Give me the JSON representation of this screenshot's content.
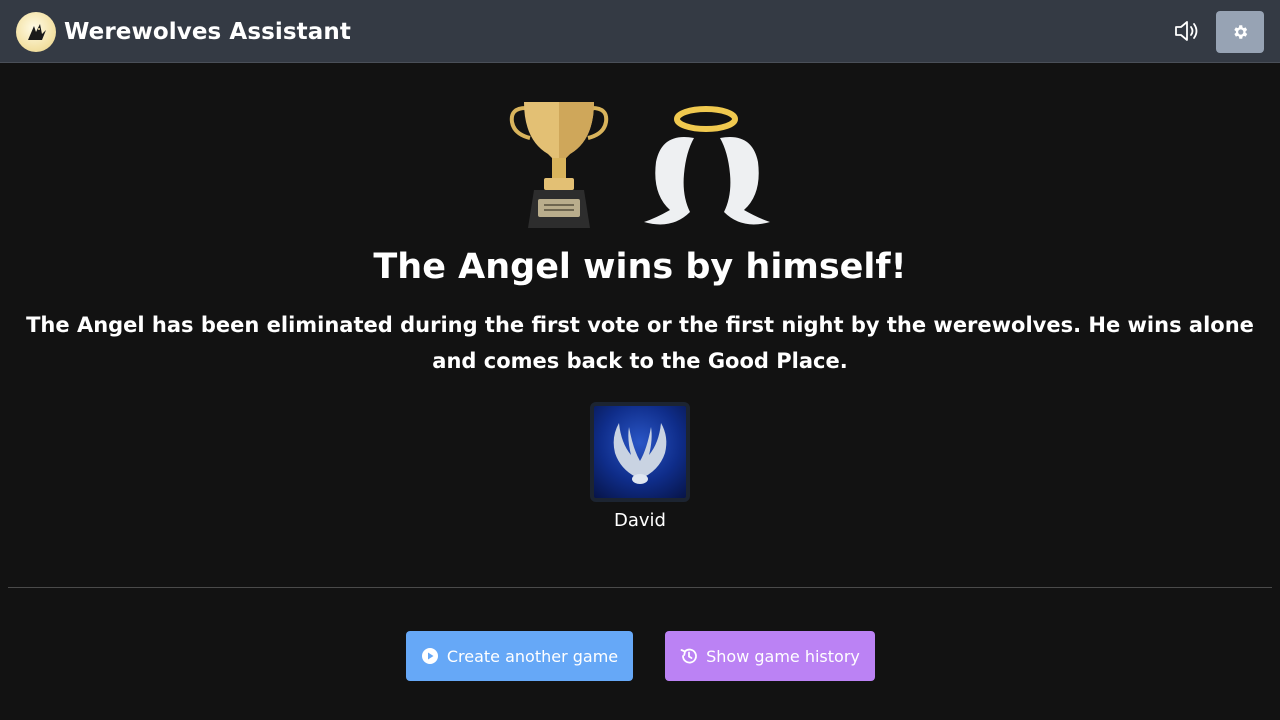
{
  "app": {
    "title": "Werewolves Assistant",
    "logo_icon": "werewolf-logo-icon"
  },
  "navbar": {
    "sound_icon": "volume-icon",
    "settings_icon": "gear-icon"
  },
  "victory": {
    "images": [
      "trophy-icon",
      "angel-wings-icon"
    ],
    "headline": "The Angel wins by himself!",
    "description": "The Angel has been eliminated during the first vote or the first night by the werewolves. He wins alone and comes back to the Good Place."
  },
  "winners": [
    {
      "name": "David",
      "role_icon": "angel-role-icon"
    }
  ],
  "actions": {
    "create_label": "Create another game",
    "create_icon": "play-circle-icon",
    "history_label": "Show game history",
    "history_icon": "history-icon"
  },
  "colors": {
    "navbar": "#343a44",
    "background": "#121212",
    "settings_button": "#97a3b4",
    "create_button": "#66a8f7",
    "history_button": "#bb82f4"
  }
}
